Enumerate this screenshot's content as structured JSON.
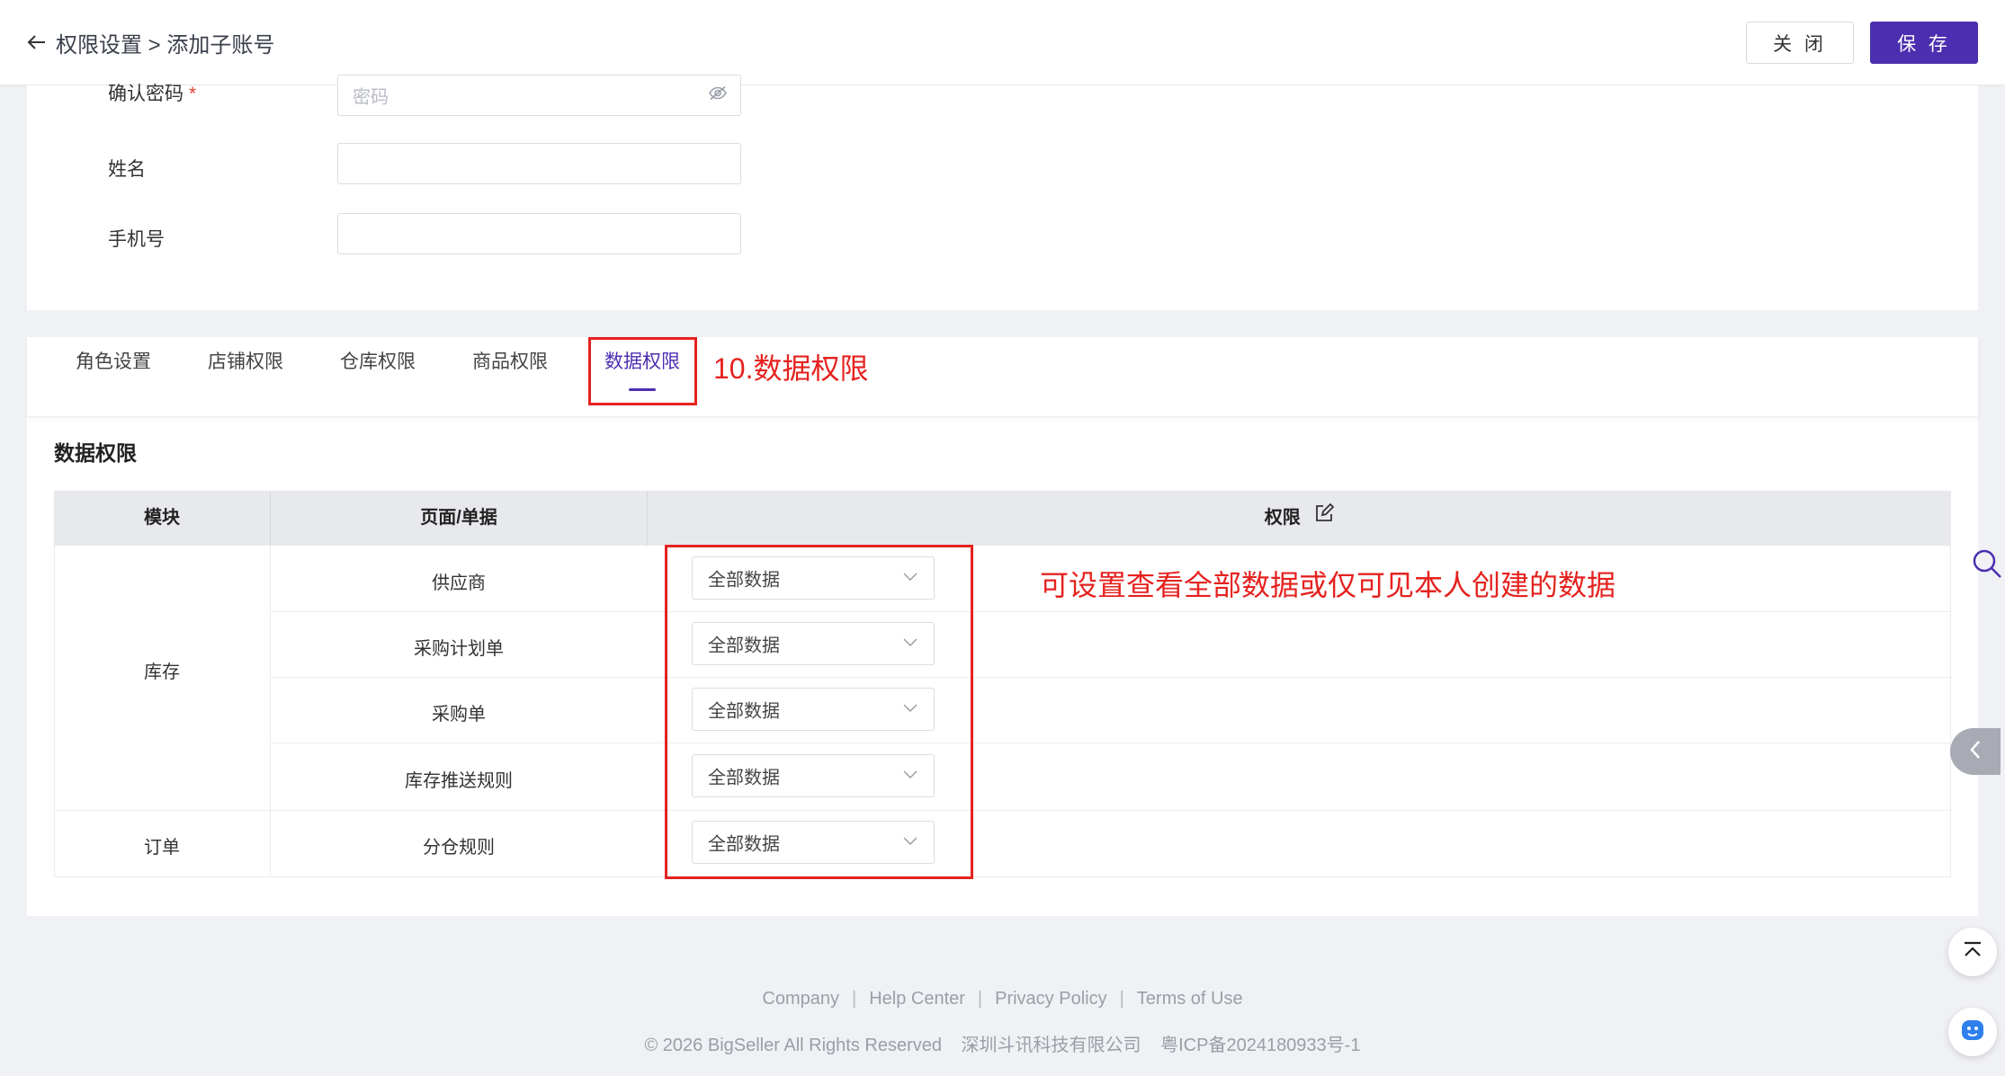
{
  "header": {
    "breadcrumb": "权限设置 > 添加子账号",
    "close_label": "关 闭",
    "save_label": "保 存"
  },
  "form": {
    "confirm_password": {
      "label": "确认密码",
      "required_mark": "*",
      "placeholder": "密码"
    },
    "name": {
      "label": "姓名",
      "value": ""
    },
    "phone": {
      "label": "手机号",
      "value": ""
    }
  },
  "tabs": [
    {
      "label": "角色设置"
    },
    {
      "label": "店铺权限"
    },
    {
      "label": "仓库权限"
    },
    {
      "label": "商品权限"
    },
    {
      "label": "数据权限",
      "active": true
    }
  ],
  "annotations": {
    "tab_note": "10.数据权限",
    "select_note": "可设置查看全部数据或仅可见本人创建的数据",
    "color": "#e5221f"
  },
  "section": {
    "title": "数据权限",
    "table": {
      "headers": {
        "module": "模块",
        "page": "页面/单据",
        "permission": "权限"
      },
      "groups": [
        {
          "module": "库存",
          "rows": [
            {
              "page": "供应商",
              "value": "全部数据"
            },
            {
              "page": "采购计划单",
              "value": "全部数据"
            },
            {
              "page": "采购单",
              "value": "全部数据"
            },
            {
              "page": "库存推送规则",
              "value": "全部数据"
            }
          ]
        },
        {
          "module": "订单",
          "rows": [
            {
              "page": "分仓规则",
              "value": "全部数据"
            }
          ]
        }
      ]
    }
  },
  "footer": {
    "links": [
      "Company",
      "Help Center",
      "Privacy Policy",
      "Terms of Use"
    ],
    "copyright": "© 2026 BigSeller All Rights Reserved",
    "company": "深圳斗讯科技有限公司",
    "icp": "粤ICP备2024180933号-1"
  },
  "colors": {
    "brand": "#4b2fb0",
    "annotation": "#e5221f"
  }
}
